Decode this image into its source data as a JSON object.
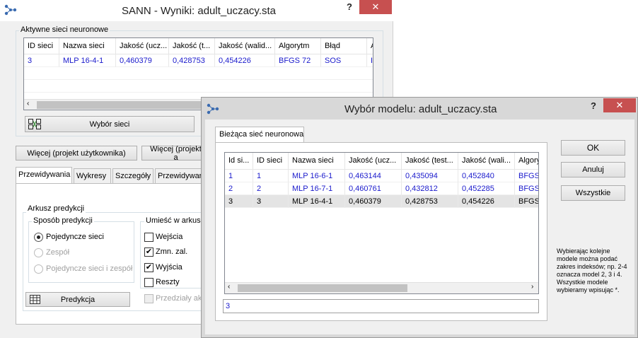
{
  "main_window": {
    "title": "SANN - Wyniki: adult_uczacy.sta",
    "help": "?",
    "close": "✕",
    "active_group_label": "Aktywne sieci neuronowe",
    "grid_headers": [
      "ID sieci",
      "Nazwa sieci",
      "Jakość (ucz...",
      "Jakość (t...",
      "Jakość (walid...",
      "Algorytm",
      "Błąd",
      "A"
    ],
    "grid_row": [
      "3",
      "MLP 16-4-1",
      "0,460379",
      "0,428753",
      "0,454226",
      "BFGS 72",
      "SOS",
      "I"
    ],
    "select_button": "Wybór sieci",
    "more_user_button": "Więcej (projekt użytkownika)",
    "more_auto_button": "Więcej (projekt a",
    "tabs": [
      "Przewidywania",
      "Wykresy",
      "Szczegóły",
      "Przewidywar"
    ],
    "predict_sheet_label": "Arkusz predykcji",
    "method_label": "Sposób predykcji",
    "radio_single": "Pojedyncze sieci",
    "radio_ensemble": "Zespół",
    "radio_both": "Pojedyncze sieci i zespół",
    "place_label": "Umieść w arkusz",
    "chk_inputs": "Wejścia",
    "chk_target": "Zmn. zal.",
    "chk_outputs": "Wyjścia",
    "chk_residuals": "Reszty",
    "chk_intervals": "Przedziały ak",
    "predict_button": "Predykcja"
  },
  "dialog": {
    "title": "Wybór modelu: adult_uczacy.sta",
    "help": "?",
    "close": "✕",
    "tab_label": "Bieżąca sieć neuronowa",
    "headers": [
      "Id si...",
      "ID sieci",
      "Nazwa sieci",
      "Jakość (ucz...",
      "Jakość (test...",
      "Jakość (wali...",
      "Algory"
    ],
    "rows": [
      [
        "1",
        "1",
        "MLP 16-6-1",
        "0,463144",
        "0,435094",
        "0,452840",
        "BFGS"
      ],
      [
        "2",
        "2",
        "MLP 16-7-1",
        "0,460761",
        "0,432812",
        "0,452285",
        "BFGS"
      ],
      [
        "3",
        "3",
        "MLP 16-4-1",
        "0,460379",
        "0,428753",
        "0,454226",
        "BFGS"
      ]
    ],
    "input_value": "3",
    "ok_button": "OK",
    "cancel_button": "Anuluj",
    "all_button": "Wszystkie",
    "hint": "Wybierając kolejne modele można podać zakres indeksów; np. 2-4 oznacza model 2, 3 i 4. Wszystkie modele wybieramy wpisując *."
  },
  "colors": {
    "selected_blue": "#1a1acc",
    "close_red": "#c75050",
    "dialog_frame": "#d8d8d8"
  }
}
